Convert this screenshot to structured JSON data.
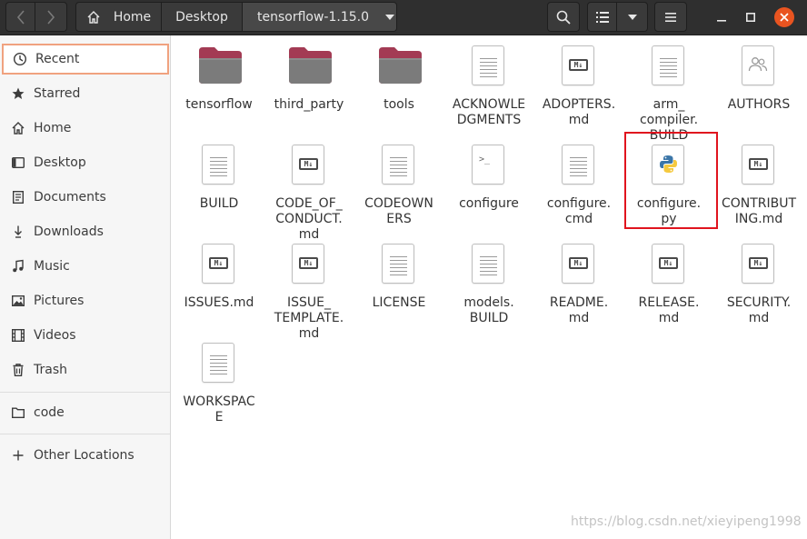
{
  "header": {
    "breadcrumbs": [
      "Home",
      "Desktop",
      "tensorflow-1.15.0"
    ],
    "icons": {
      "back": "chevron-left-icon",
      "forward": "chevron-right-icon",
      "home": "home-icon",
      "dropdown": "caret-down-icon",
      "search": "search-icon",
      "list_view": "list-view-icon",
      "view_options": "caret-down-icon",
      "menu": "hamburger-menu-icon",
      "minimize": "minimize-icon",
      "maximize": "maximize-icon",
      "close": "close-icon"
    },
    "colors": {
      "bar": "#2f2f2f",
      "close": "#e95420"
    }
  },
  "sidebar": {
    "items": [
      {
        "label": "Recent",
        "icon": "clock-icon",
        "selected": true
      },
      {
        "label": "Starred",
        "icon": "star-icon"
      },
      {
        "label": "Home",
        "icon": "home-icon"
      },
      {
        "label": "Desktop",
        "icon": "desktop-icon"
      },
      {
        "label": "Documents",
        "icon": "document-icon"
      },
      {
        "label": "Downloads",
        "icon": "download-icon"
      },
      {
        "label": "Music",
        "icon": "music-icon"
      },
      {
        "label": "Pictures",
        "icon": "picture-icon"
      },
      {
        "label": "Videos",
        "icon": "video-icon"
      },
      {
        "label": "Trash",
        "icon": "trash-icon"
      },
      {
        "label": "code",
        "icon": "folder-icon"
      },
      {
        "label": "Other Locations",
        "icon": "plus-icon"
      }
    ],
    "selected_border_color": "#f0a27f"
  },
  "files": [
    {
      "name": "tensorflow",
      "type": "folder"
    },
    {
      "name": "third_party",
      "type": "folder"
    },
    {
      "name": "tools",
      "type": "folder"
    },
    {
      "name": "ACKNOWLE\nDGMENTS",
      "type": "text"
    },
    {
      "name": "ADOPTERS.\nmd",
      "type": "markdown"
    },
    {
      "name": "arm_\ncompiler.\nBUILD",
      "type": "text"
    },
    {
      "name": "AUTHORS",
      "type": "contacts"
    },
    {
      "name": "BUILD",
      "type": "text"
    },
    {
      "name": "CODE_OF_\nCONDUCT.\nmd",
      "type": "markdown"
    },
    {
      "name": "CODEOWN\nERS",
      "type": "text"
    },
    {
      "name": "configure",
      "type": "script"
    },
    {
      "name": "configure.\ncmd",
      "type": "text"
    },
    {
      "name": "configure.\npy",
      "type": "python",
      "highlighted": true
    },
    {
      "name": "CONTRIBUT\nING.md",
      "type": "markdown"
    },
    {
      "name": "ISSUES.md",
      "type": "markdown"
    },
    {
      "name": "ISSUE_\nTEMPLATE.\nmd",
      "type": "markdown"
    },
    {
      "name": "LICENSE",
      "type": "text"
    },
    {
      "name": "models.\nBUILD",
      "type": "text"
    },
    {
      "name": "README.\nmd",
      "type": "markdown"
    },
    {
      "name": "RELEASE.\nmd",
      "type": "markdown"
    },
    {
      "name": "SECURITY.\nmd",
      "type": "markdown"
    },
    {
      "name": "WORKSPAC\nE",
      "type": "text"
    }
  ],
  "folder_color": "#a33b54",
  "highlight_color": "#e0141e",
  "watermark": "https://blog.csdn.net/xieyipeng1998"
}
